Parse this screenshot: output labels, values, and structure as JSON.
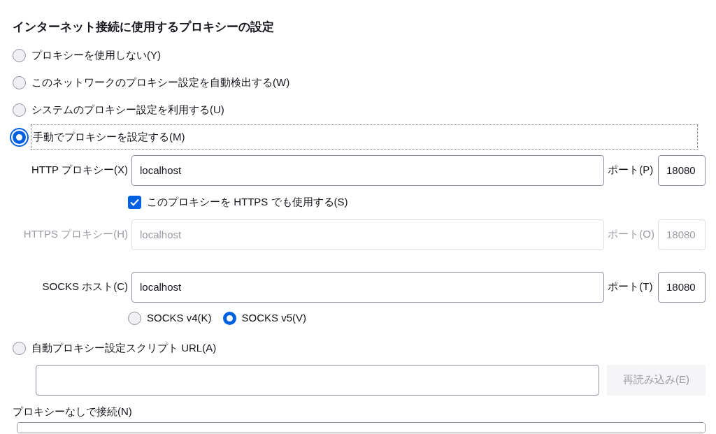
{
  "heading": "インターネット接続に使用するプロキシーの設定",
  "modes": [
    {
      "kind": "plain",
      "label": "プロキシーを使用しない(Y)",
      "selected": false,
      "focused": false
    },
    {
      "kind": "plain",
      "label": "このネットワークのプロキシー設定を自動検出する(W)",
      "selected": false,
      "focused": false
    },
    {
      "kind": "plain",
      "label": "システムのプロキシー設定を利用する(U)",
      "selected": false,
      "focused": false
    },
    {
      "kind": "manual",
      "label": "手動でプロキシーを設定する(M)",
      "selected": true,
      "focused": true,
      "http": {
        "label": "HTTP プロキシー(X)",
        "value": "localhost",
        "port_label": "ポート(P)",
        "port": "18080",
        "disabled": false
      },
      "share": {
        "label": "このプロキシーを HTTPS でも使用する(S)",
        "checked": true
      },
      "https": {
        "label": "HTTPS プロキシー(H)",
        "value": "localhost",
        "port_label": "ポート(O)",
        "port": "18080",
        "disabled": true
      },
      "socks": {
        "label": "SOCKS ホスト(C)",
        "value": "localhost",
        "port_label": "ポート(T)",
        "port": "18080",
        "disabled": false
      },
      "socks_versions": [
        {
          "label": "SOCKS v4(K)",
          "selected": false
        },
        {
          "label": "SOCKS v5(V)",
          "selected": true
        }
      ]
    },
    {
      "kind": "pac",
      "label": "自動プロキシー設定スクリプト URL(A)",
      "selected": false,
      "focused": false,
      "reload": {
        "label": "再読み込み(E)",
        "disabled": true
      }
    }
  ],
  "no_proxy": {
    "label": "プロキシーなしで接続(N)"
  }
}
